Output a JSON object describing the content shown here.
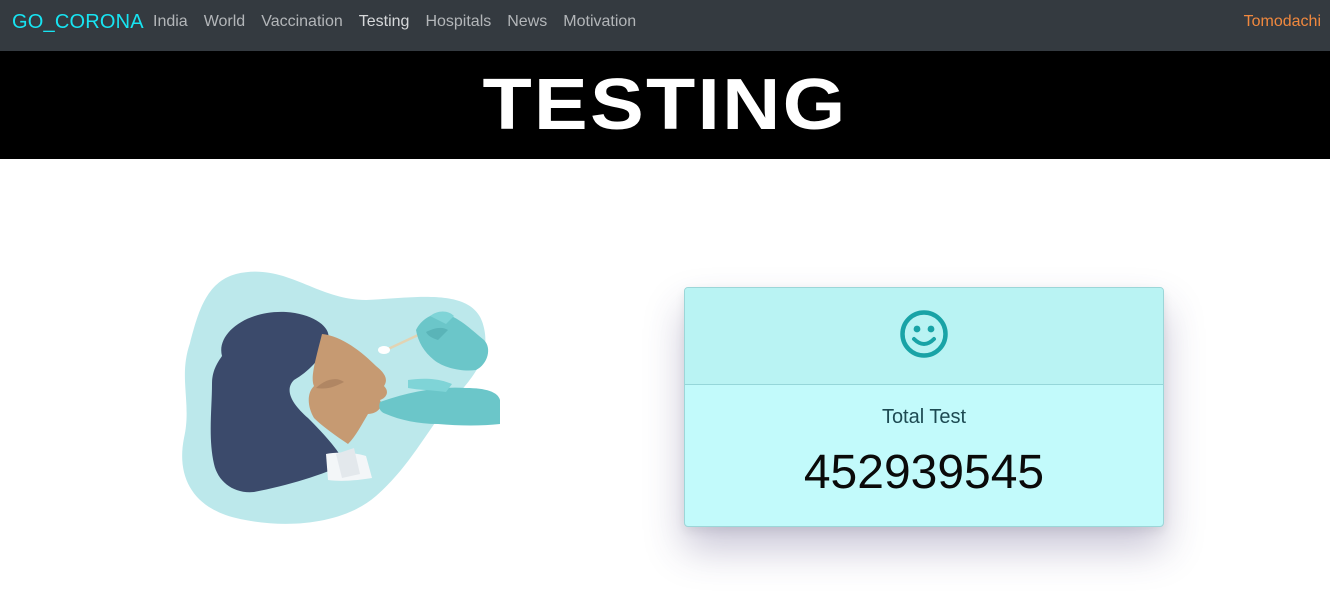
{
  "navbar": {
    "brand": "GO_CORONA",
    "links": [
      {
        "label": "India"
      },
      {
        "label": "World"
      },
      {
        "label": "Vaccination"
      },
      {
        "label": "Testing"
      },
      {
        "label": "Hospitals"
      },
      {
        "label": "News"
      },
      {
        "label": "Motivation"
      }
    ],
    "user": "Tomodachi"
  },
  "banner": {
    "title": "TESTING"
  },
  "illustration": {
    "icon": "nasal-swab-test-illustration"
  },
  "card": {
    "icon": "smiley-face-icon",
    "label": "Total Test",
    "value": "452939545"
  },
  "colors": {
    "brand": "#17e4f2",
    "user": "#f0883e",
    "navbar_bg": "#343a40",
    "card_header": "#b9f3f3",
    "card_body": "#c2fafb",
    "icon": "#19a3a6"
  }
}
